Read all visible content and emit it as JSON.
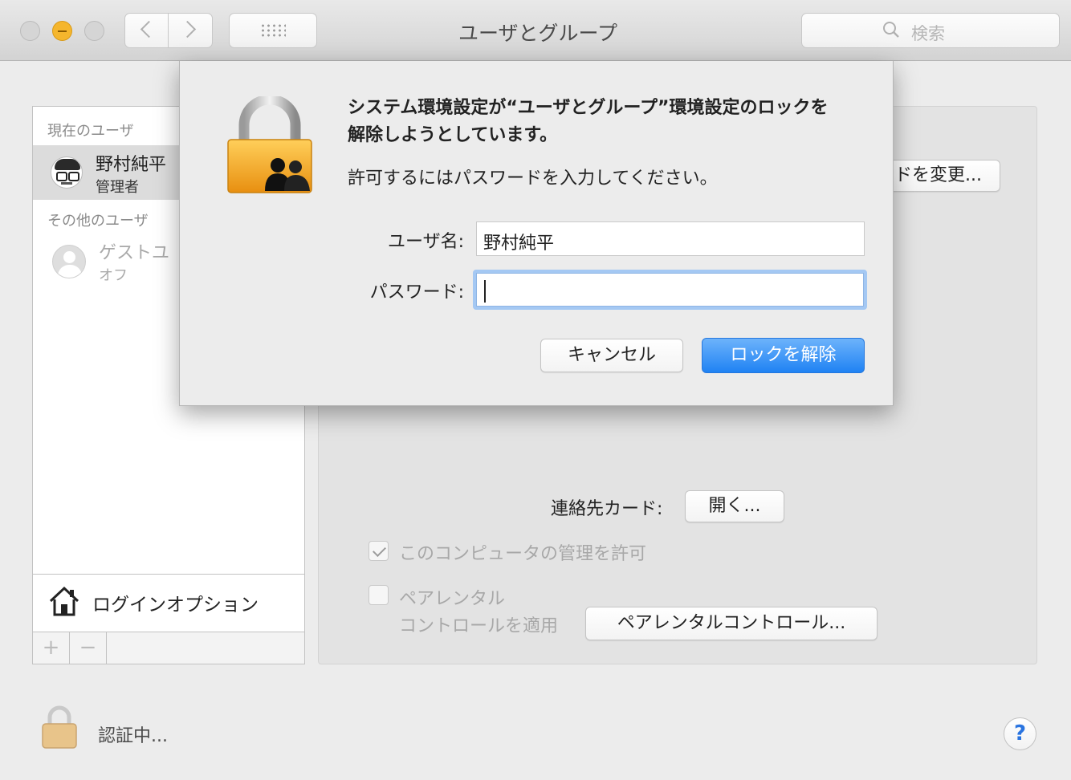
{
  "window": {
    "title": "ユーザとグループ",
    "search_placeholder": "検索"
  },
  "sidebar": {
    "current_users_header": "現在のユーザ",
    "current_user": {
      "name": "野村純平",
      "role": "管理者"
    },
    "other_users_header": "その他のユーザ",
    "guest": {
      "name": "ゲストユ",
      "status": "オフ"
    },
    "login_options_label": "ログインオプション",
    "add_symbol": "+",
    "remove_symbol": "−"
  },
  "panel": {
    "change_password_button": "ドを変更...",
    "contact_card_label": "連絡先カード:",
    "contact_open_button": "開く...",
    "admin_checkbox_label": "このコンピュータの管理を許可",
    "admin_checked": true,
    "parental_label_line1": "ペアレンタル",
    "parental_label_line2": "コントロールを適用",
    "parental_checked": false,
    "parental_button": "ペアレンタルコントロール..."
  },
  "status": {
    "auth_text": "認証中...",
    "help_symbol": "?"
  },
  "dialog": {
    "message_line1": "システム環境設定が“ユーザとグループ”環境設定のロックを",
    "message_line2": "解除しようとしています。",
    "instruction": "許可するにはパスワードを入力してください。",
    "username_label": "ユーザ名:",
    "username_value": "野村純平",
    "password_label": "パスワード:",
    "password_value": "",
    "cancel_button": "キャンセル",
    "unlock_button": "ロックを解除"
  },
  "colors": {
    "accent_blue": "#1f82f3",
    "minimize_yellow": "#f5b62d",
    "lock_orange": "#f0a21a"
  }
}
